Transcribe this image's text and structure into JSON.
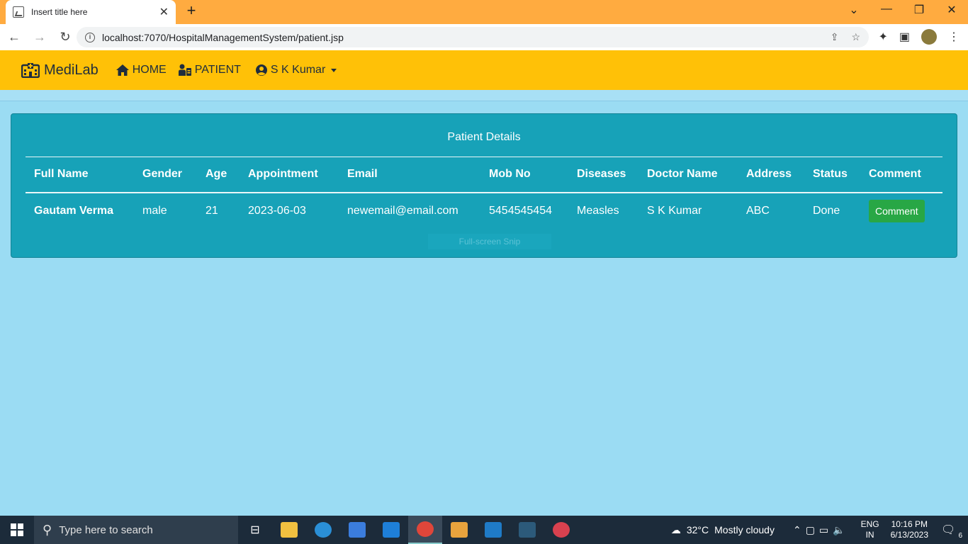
{
  "browser": {
    "tab_title": "Insert title here",
    "new_tab": "+",
    "url": "localhost:7070/HospitalManagementSystem/patient.jsp"
  },
  "navbar": {
    "brand": "MediLab",
    "home": "HOME",
    "patient": "PATIENT",
    "user": "S K Kumar"
  },
  "card": {
    "title": "Patient Details",
    "columns": [
      "Full Name",
      "Gender",
      "Age",
      "Appointment",
      "Email",
      "Mob No",
      "Diseases",
      "Doctor Name",
      "Address",
      "Status",
      "Comment"
    ],
    "rows": [
      {
        "full_name": "Gautam Verma",
        "gender": "male",
        "age": "21",
        "appointment": "2023-06-03",
        "email": "newemail@email.com",
        "mob_no": "5454545454",
        "diseases": "Measles",
        "doctor": "S K Kumar",
        "address": "ABC",
        "status": "Done",
        "comment_label": "Comment"
      }
    ],
    "snip_overlay": "Full-screen Snip"
  },
  "taskbar": {
    "search_placeholder": "Type here to search",
    "weather_temp": "32°C",
    "weather_text": "Mostly cloudy",
    "lang_line1": "ENG",
    "lang_line2": "IN",
    "time": "10:16 PM",
    "date": "6/13/2023",
    "notifications": "6"
  },
  "colors": {
    "tab_bar": "#ffab40",
    "navbar": "#ffc107",
    "page_bg": "#9bdcf3",
    "card_bg": "#17a2b8",
    "comment_button": "#28a745"
  }
}
